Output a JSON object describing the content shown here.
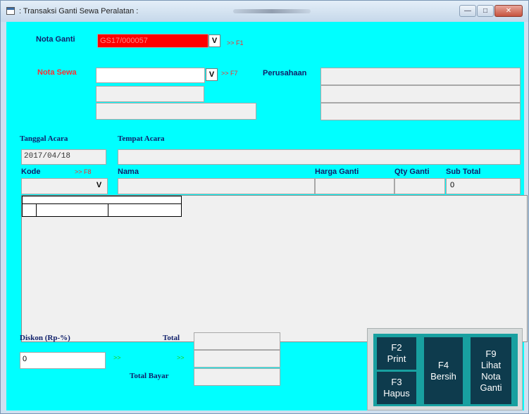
{
  "window": {
    "title": ": Transaksi Ganti Sewa Peralatan :",
    "btn_min": "—",
    "btn_max": "□",
    "btn_close": "✕"
  },
  "colors": {
    "form_bg": "#00ffff",
    "label_navy": "#10206a",
    "hint_red": "#ff2a2a",
    "button_bg": "#0e3b4d"
  },
  "header": {
    "nota_ganti_label": "Nota Ganti",
    "nota_ganti_value": "GS17/000057",
    "dropdown_glyph": "V",
    "f1_hint": ">> F1",
    "nota_sewa_label": "Nota Sewa",
    "nota_sewa_value": "",
    "f7_hint": ">> F7",
    "perusahaan_label": "Perusahaan"
  },
  "acara": {
    "tanggal_label": "Tanggal Acara",
    "tanggal_value": "2017/04/18",
    "tempat_label": "Tempat Acara",
    "tempat_value": ""
  },
  "columns": {
    "kode": "Kode",
    "f8_hint": ">> F8",
    "nama": "Nama",
    "harga_ganti": "Harga Ganti",
    "qty_ganti": "Qty Ganti",
    "sub_total": "Sub Total"
  },
  "entry": {
    "kode_value": "",
    "sub_total_value": "0"
  },
  "footer": {
    "diskon_label": "Diskon (Rp-%)",
    "diskon_value": "0",
    "diskon_arrow": ">>",
    "total_label": "Total",
    "total_arrow": ">>",
    "total_bayar_label": "Total Bayar"
  },
  "buttons": {
    "print": {
      "key": "F2",
      "label": "Print"
    },
    "hapus": {
      "key": "F3",
      "label": "Hapus"
    },
    "bersih": {
      "key": "F4",
      "label": "Bersih"
    },
    "lihat": {
      "key": "F9",
      "line1": "Lihat",
      "line2": "Nota",
      "line3": "Ganti"
    }
  },
  "icons": [
    "app-icon",
    "minimize-icon",
    "maximize-icon",
    "close-icon"
  ]
}
